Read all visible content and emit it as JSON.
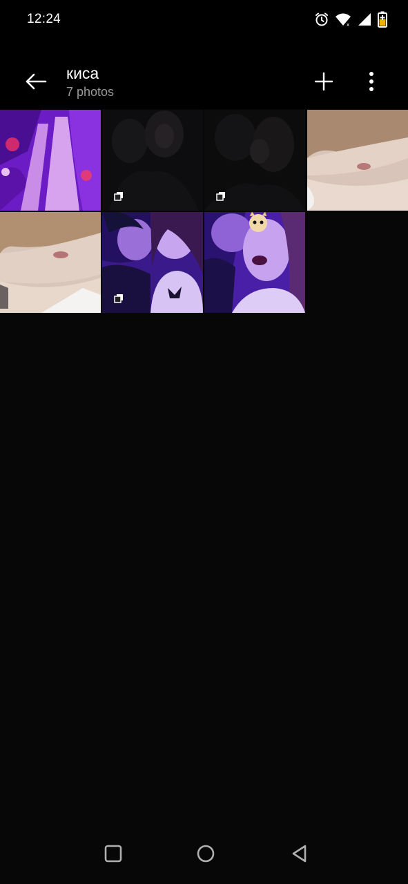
{
  "status_bar": {
    "time": "12:24",
    "icons": [
      "alarm-icon",
      "wifi-icon",
      "cell-signal-icon",
      "battery-charging-icon"
    ]
  },
  "app_bar": {
    "title": "киса",
    "subtitle": "7 photos",
    "back_icon": "arrow-left-icon",
    "add_icon": "plus-icon",
    "more_icon": "more-vertical-icon"
  },
  "photos": [
    {
      "scene": "purple-lit legs on bed",
      "multiple": false
    },
    {
      "scene": "dark selfie of two people",
      "multiple": true
    },
    {
      "scene": "dark selfie of two people kissing",
      "multiple": true
    },
    {
      "scene": "neck and shoulder close-up",
      "multiple": false
    },
    {
      "scene": "neck and shoulder close-up",
      "multiple": false
    },
    {
      "scene": "purple-lit selfie of two people",
      "multiple": true
    },
    {
      "scene": "purple-lit selfie with cat sticker",
      "multiple": false
    }
  ],
  "nav_bar": {
    "icons": [
      "recents-square-icon",
      "home-circle-icon",
      "back-triangle-icon"
    ]
  },
  "colors": {
    "background": "#070707",
    "bar_background": "#000000",
    "text_primary": "#ffffff",
    "text_secondary": "#9a9a9a",
    "purple": "#7c22d8",
    "battery_fill": "#f4b000"
  }
}
